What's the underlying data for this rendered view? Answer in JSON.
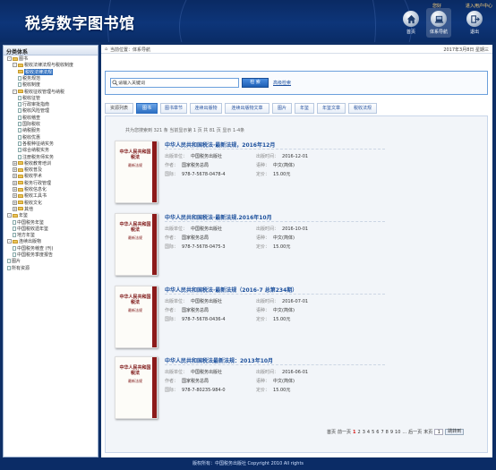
{
  "header": {
    "logo": "税务数字图书馆",
    "greeting": "您好",
    "user_center": "进入用户中心",
    "nav": [
      {
        "label": "首页",
        "icon": "home-icon"
      },
      {
        "label": "体系导航",
        "icon": "system-nav-icon"
      },
      {
        "label": "退出",
        "icon": "exit-icon"
      }
    ]
  },
  "sidebar": {
    "title": "分类体系",
    "items": [
      {
        "label": "图书",
        "depth": 0,
        "type": "folder",
        "toggle": "-"
      },
      {
        "label": "税收法律法规与税收制度",
        "depth": 1,
        "type": "folder",
        "toggle": "-"
      },
      {
        "label": "税收法律法规",
        "depth": 2,
        "type": "folder",
        "selected": true
      },
      {
        "label": "税务规范",
        "depth": 2,
        "type": "doc"
      },
      {
        "label": "税收制度",
        "depth": 2,
        "type": "doc"
      },
      {
        "label": "税收征收管理与纳税",
        "depth": 1,
        "type": "folder",
        "toggle": "-"
      },
      {
        "label": "税收征管",
        "depth": 2,
        "type": "doc"
      },
      {
        "label": "行政审批指南",
        "depth": 2,
        "type": "doc"
      },
      {
        "label": "税收风险管理",
        "depth": 2,
        "type": "doc"
      },
      {
        "label": "税收稽查",
        "depth": 2,
        "type": "doc"
      },
      {
        "label": "国际税收",
        "depth": 2,
        "type": "doc"
      },
      {
        "label": "纳税服务",
        "depth": 2,
        "type": "doc"
      },
      {
        "label": "税收优惠",
        "depth": 2,
        "type": "doc"
      },
      {
        "label": "各税种征纳实务",
        "depth": 2,
        "type": "doc"
      },
      {
        "label": "综合纳税实务",
        "depth": 2,
        "type": "doc"
      },
      {
        "label": "注册税务师实务",
        "depth": 2,
        "type": "doc"
      },
      {
        "label": "税收教育培训",
        "depth": 1,
        "type": "folder",
        "toggle": "+"
      },
      {
        "label": "税收普及",
        "depth": 1,
        "type": "folder",
        "toggle": "+"
      },
      {
        "label": "税收学术",
        "depth": 1,
        "type": "folder",
        "toggle": "+"
      },
      {
        "label": "税务行政管理",
        "depth": 1,
        "type": "folder",
        "toggle": "+"
      },
      {
        "label": "税收信息化",
        "depth": 1,
        "type": "folder",
        "toggle": "+"
      },
      {
        "label": "税收工具书",
        "depth": 1,
        "type": "folder",
        "toggle": "+"
      },
      {
        "label": "税收文化",
        "depth": 1,
        "type": "folder",
        "toggle": "+"
      },
      {
        "label": "其他",
        "depth": 1,
        "type": "folder",
        "toggle": "+"
      },
      {
        "label": "年鉴",
        "depth": 0,
        "type": "folder",
        "toggle": "-"
      },
      {
        "label": "中国税务年鉴",
        "depth": 1,
        "type": "doc"
      },
      {
        "label": "中国税收遗年鉴",
        "depth": 1,
        "type": "doc"
      },
      {
        "label": "地方年鉴",
        "depth": 1,
        "type": "doc"
      },
      {
        "label": "连续出版物",
        "depth": 0,
        "type": "folder",
        "toggle": "-"
      },
      {
        "label": "中国税务稽查 (刊)",
        "depth": 1,
        "type": "doc"
      },
      {
        "label": "中国税务季度报告",
        "depth": 1,
        "type": "doc"
      },
      {
        "label": "图片",
        "depth": 0,
        "type": "doc"
      },
      {
        "label": "所有资源",
        "depth": 0,
        "type": "doc"
      }
    ]
  },
  "breadcrumb": {
    "prefix": "当前位置：",
    "current": "体系导航",
    "date": "2017年3月8日 星期三"
  },
  "search": {
    "placeholder": "请输入关键词",
    "value": "请输入关键词",
    "button": "检 索",
    "advanced": "高级检索"
  },
  "tabs": [
    {
      "label": "资源列表",
      "active": false,
      "first": true
    },
    {
      "label": "图书",
      "active": true
    },
    {
      "label": "图书章节",
      "active": false
    },
    {
      "label": "连续出版物",
      "active": false
    },
    {
      "label": "连续出版物文章",
      "active": false
    },
    {
      "label": "图片",
      "active": false
    },
    {
      "label": "年鉴",
      "active": false
    },
    {
      "label": "年鉴文章",
      "active": false
    },
    {
      "label": "税收法规",
      "active": false
    }
  ],
  "stats": "共为您搜索到 321 条 当前显示第 1 页 共 81 页 显示 1-4条",
  "labels": {
    "publisher": "出版单位：",
    "pub_date": "出版时间：",
    "author": "作者：",
    "language": "语种：",
    "isbn": "国际：",
    "price": "定价："
  },
  "books": [
    {
      "title": "中华人民共和国税法·最新法规，2016年12月",
      "publisher": "中国税务出版社",
      "pub_date": "2016-12-01",
      "author": "国家税务总局",
      "language": "中文(简体)",
      "isbn": "978-7-5678-0478-4",
      "price": "15.00元",
      "cover_title": "中华人民共和国税法",
      "cover_sub": "最新法规"
    },
    {
      "title": "中华人民共和国税法·最新法规.2016年10月",
      "publisher": "中国税务出版社",
      "pub_date": "2016-10-01",
      "author": "国家税务总局",
      "language": "中文(简体)",
      "isbn": "978-7-5678-0475-3",
      "price": "15.00元",
      "cover_title": "中华人民共和国税法",
      "cover_sub": "最新法规"
    },
    {
      "title": "中华人民共和国税法·最新法规（2016-7 总第234期）",
      "publisher": "中国税务出版社",
      "pub_date": "2016-07-01",
      "author": "国家税务总局",
      "language": "中文(简体)",
      "isbn": "978-7-5678-0436-4",
      "price": "15.00元",
      "cover_title": "中华人民共和国税法",
      "cover_sub": "最新法规"
    },
    {
      "title": "中华人民共和国税法最新法规：2013年10月",
      "publisher": "中国税务出版社",
      "pub_date": "2016-06-01",
      "author": "国家税务总局",
      "language": "中文(简体)",
      "isbn": "978-7-80235-984-0",
      "price": "15.00元",
      "cover_title": "中华人民共和国税法",
      "cover_sub": "最新法规"
    }
  ],
  "pager": {
    "first": "首页",
    "prev": "前一页",
    "pages": [
      "1",
      "2",
      "3",
      "4",
      "5",
      "6",
      "7",
      "8",
      "9",
      "10",
      "..."
    ],
    "current": "1",
    "next": "后一页",
    "last": "末页",
    "goto_value": "1",
    "goto_label": "跳转到"
  },
  "footer": "版权所有：中国税务出版社 Copyright 2010 All rights"
}
